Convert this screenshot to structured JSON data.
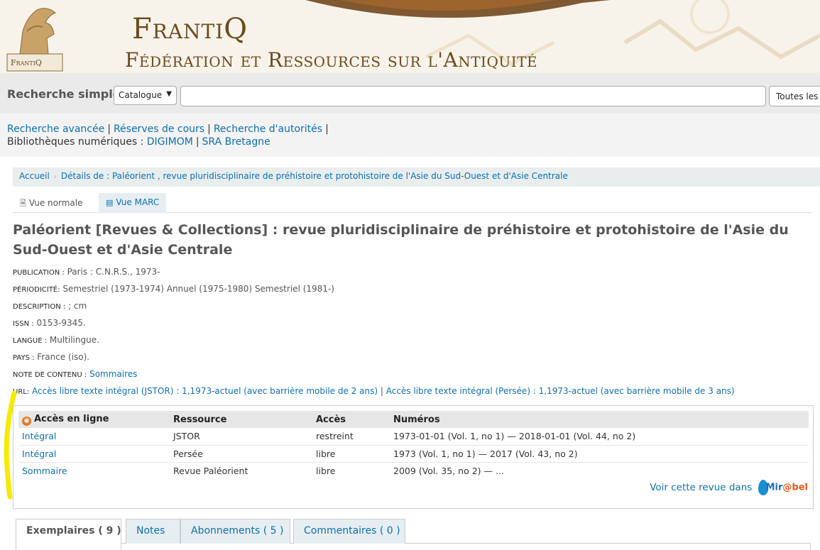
{
  "banner": {
    "title": "FrantiQ",
    "subtitle": "Fédération et Ressources sur l'Antiquité",
    "logo_text": "FrantiQ"
  },
  "search": {
    "label": "Recherche simple",
    "catalog_option": "Catalogue",
    "query": "",
    "scope": "Toutes les bibliothèques"
  },
  "links": {
    "advanced": "Recherche avancée",
    "course_reserves": "Réserves de cours",
    "authorities": "Recherche d'autorités",
    "digital_label": "Bibliothèques numériques :",
    "digimom": "DIGIMOM",
    "sra": "SRA Bretagne"
  },
  "breadcrumb": {
    "home": "Accueil",
    "current": "Détails de : Paléorient , revue pluridisciplinaire de préhistoire et protohistoire de l'Asie du Sud-Ouest et d'Asie Centrale"
  },
  "view_tabs": {
    "normal": "Vue normale",
    "marc": "Vue MARC"
  },
  "record": {
    "title": "Paléorient [Revues & Collections] : revue pluridisciplinaire de préhistoire et protohistoire de l'Asie du Sud-Ouest et d'Asie Centrale",
    "publication_label": "Publication :",
    "publication": "Paris : C.N.R.S., 1973-",
    "periodicity_label": "Périodicité:",
    "periodicity": "Semestriel (1973-1974) Annuel (1975-1980) Semestriel (1981-)",
    "description_label": "Description :",
    "description": "; cm",
    "issn_label": "ISSN :",
    "issn": "0153-9345.",
    "language_label": "Langue :",
    "language": "Multilingue.",
    "country_label": "Pays :",
    "country": "France (iso).",
    "contents_label": "Note de contenu :",
    "contents": "Sommaires",
    "url_label": "URL:",
    "url1": "Accès libre texte intégral (JSTOR) : 1,1973-actuel (avec barrière mobile de 2 ans)",
    "url_sep": "|",
    "url2": "Accès libre texte intégral (Persée) : 1,1973-actuel (avec barrière mobile de 3 ans)"
  },
  "online_access": {
    "headers": [
      "Accès en ligne",
      "Ressource",
      "Accès",
      "Numéros"
    ],
    "rows": [
      {
        "link": "Intégral",
        "resource": "JSTOR",
        "access": "restreint",
        "issues": "1973-01-01 (Vol. 1, no 1) — 2018-01-01 (Vol. 44, no 2)"
      },
      {
        "link": "Intégral",
        "resource": "Persée",
        "access": "libre",
        "issues": "1973 (Vol. 1, no 1) — 2017 (Vol. 43, no 2)"
      },
      {
        "link": "Sommaire",
        "resource": "Revue Paléorient",
        "access": "libre",
        "issues": "2009 (Vol. 35, no 2) — ..."
      }
    ],
    "mirabel_text": "Voir cette revue dans",
    "mirabel_logo_a": "Mir",
    "mirabel_logo_b": "@bel"
  },
  "bottom_tabs": {
    "items": "Exemplaires ( 9 )",
    "notes": "Notes",
    "subscriptions": "Abonnements ( 5 )",
    "comments": "Commentaires ( 0 )"
  },
  "colors": {
    "link": "#0f6fa8",
    "banner_bg": "#f8f3ea",
    "banner_text": "#6a4b1e",
    "highlight": "#f5ea00"
  }
}
